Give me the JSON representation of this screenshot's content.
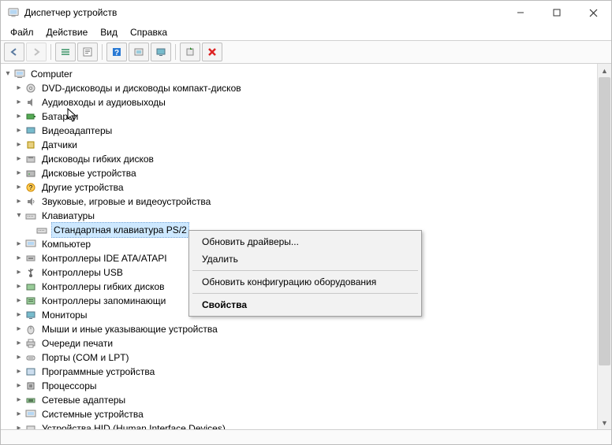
{
  "window": {
    "title": "Диспетчер устройств"
  },
  "menu": {
    "file": "Файл",
    "action": "Действие",
    "view": "Вид",
    "help": "Справка"
  },
  "tree": {
    "root": "Computer",
    "items": {
      "dvd": "DVD-дисководы и дисководы компакт-дисков",
      "audio": "Аудиовходы и аудиовыходы",
      "battery": "Батареи",
      "video": "Видеоадаптеры",
      "sensors": "Датчики",
      "floppy": "Дисководы гибких дисков",
      "disk": "Дисковые устройства",
      "other": "Другие устройства",
      "sound": "Звуковые, игровые и видеоустройства",
      "keyboards": "Клавиатуры",
      "keyboard_child": "Стандартная клавиатура PS/2",
      "computer": "Компьютер",
      "ide": "Контроллеры IDE ATA/ATAPI",
      "usb": "Контроллеры USB",
      "fdc": "Контроллеры гибких дисков",
      "storage": "Контроллеры запоминающи",
      "monitors": "Мониторы",
      "hid_point": "Мыши и иные указывающие устройства",
      "print": "Очереди печати",
      "ports": "Порты (COM и LPT)",
      "soft": "Программные устройства",
      "cpu": "Процессоры",
      "net": "Сетевые адаптеры",
      "sys": "Системные устройства",
      "hid": "Устройства HID (Human Interface Devices)"
    }
  },
  "context_menu": {
    "update": "Обновить драйверы...",
    "delete": "Удалить",
    "scan": "Обновить конфигурацию оборудования",
    "props": "Свойства"
  }
}
